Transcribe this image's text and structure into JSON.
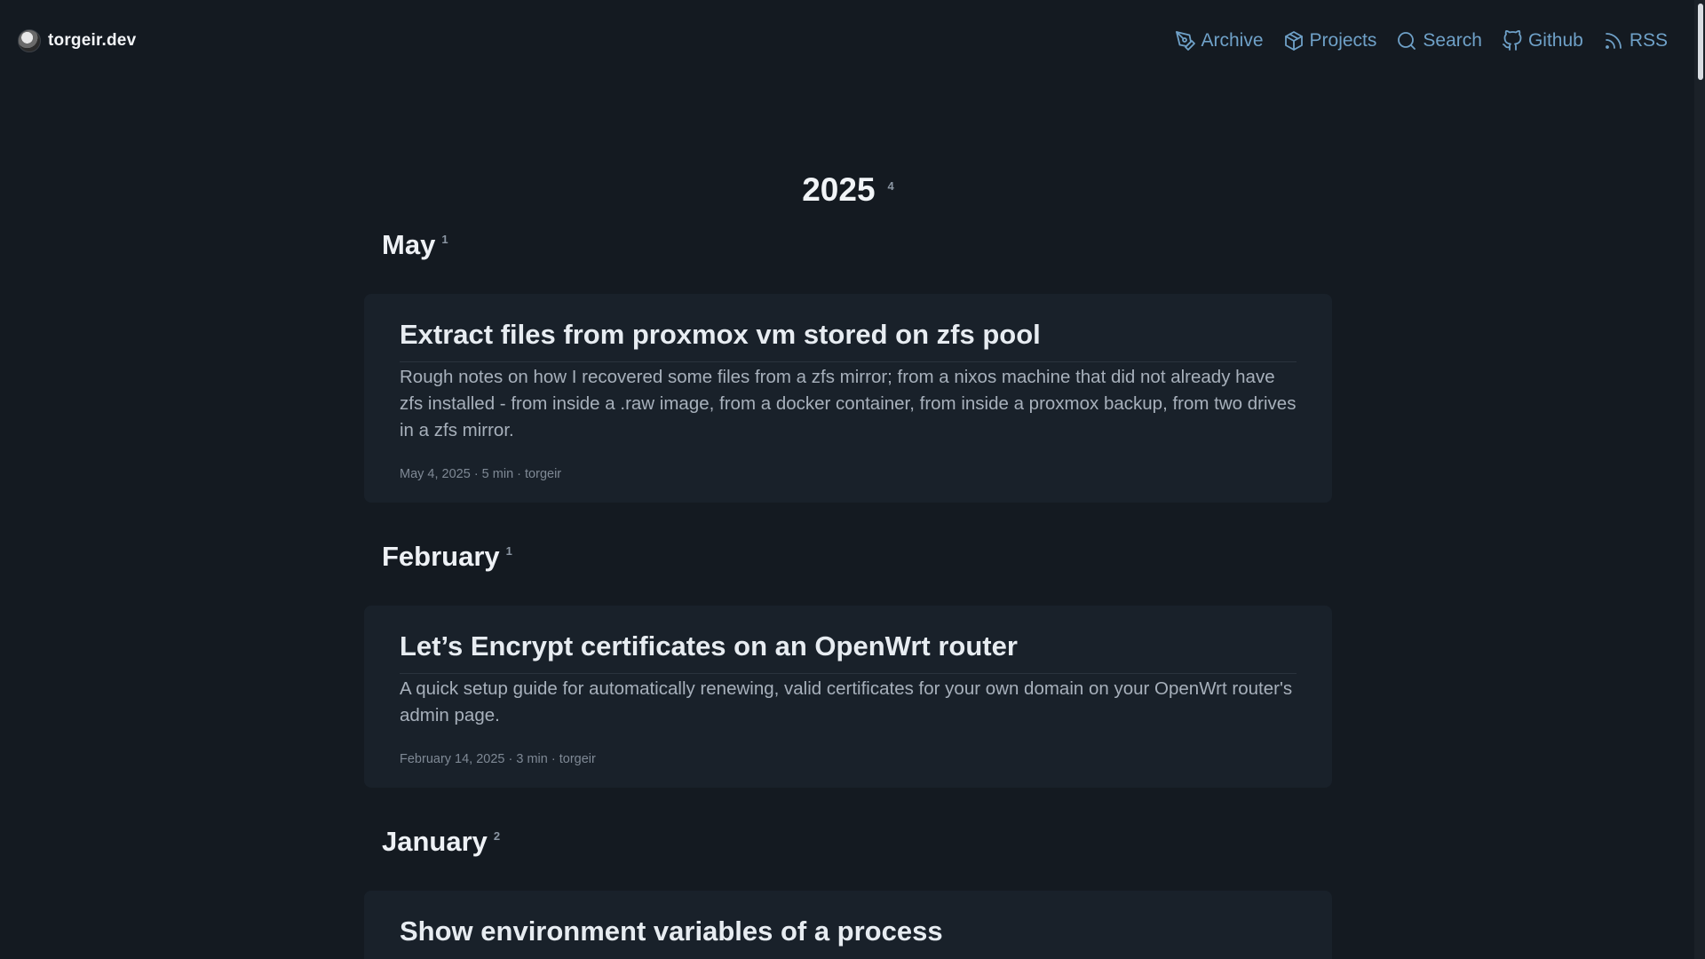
{
  "header": {
    "site_name": "torgeir.dev",
    "nav": [
      {
        "label": "Archive",
        "icon": "pen-tool-icon"
      },
      {
        "label": "Projects",
        "icon": "package-icon"
      },
      {
        "label": "Search",
        "icon": "search-icon"
      },
      {
        "label": "Github",
        "icon": "github-icon"
      },
      {
        "label": "RSS",
        "icon": "rss-icon"
      }
    ]
  },
  "colors": {
    "background": "#141a21",
    "card": "#19212a",
    "link": "#6fa1c8"
  },
  "archive": {
    "year": "2025",
    "year_count": "4",
    "months": [
      {
        "name": "May",
        "count": "1",
        "posts": [
          {
            "title": "Extract files from proxmox vm stored on zfs pool",
            "description": "Rough notes on how I recovered some files from a zfs mirror; from a nixos machine that did not already have zfs installed - from inside a .raw image, from a docker container, from inside a proxmox backup, from two drives in a zfs mirror.",
            "meta": "May 4, 2025 · 5 min · torgeir"
          }
        ]
      },
      {
        "name": "February",
        "count": "1",
        "posts": [
          {
            "title": "Let’s Encrypt certificates on an OpenWrt router",
            "description": "A quick setup guide for automatically renewing, valid certificates for your own domain on your OpenWrt router's admin page.",
            "meta": "February 14, 2025 · 3 min · torgeir"
          }
        ]
      },
      {
        "name": "January",
        "count": "2",
        "posts": [
          {
            "title": "Show environment variables of a process"
          }
        ]
      }
    ]
  }
}
